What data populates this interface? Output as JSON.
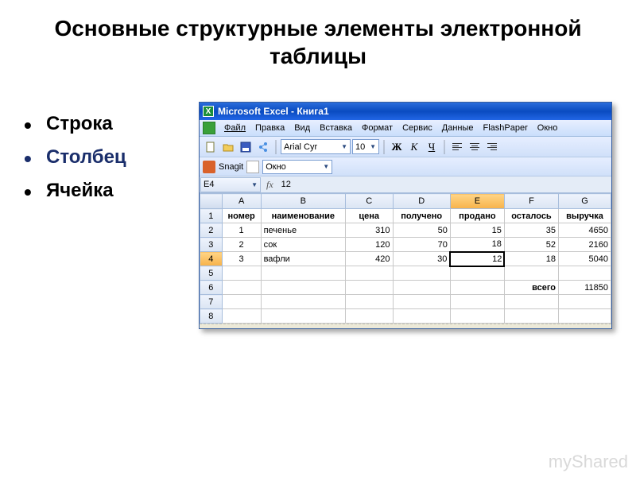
{
  "slide": {
    "title": "Основные структурные элементы электронной таблицы",
    "bullets": [
      "Строка",
      "Столбец",
      "Ячейка"
    ]
  },
  "excel": {
    "title": "Microsoft Excel - Книга1",
    "menu": [
      "Файл",
      "Правка",
      "Вид",
      "Вставка",
      "Формат",
      "Сервис",
      "Данные",
      "FlashPaper",
      "Окно"
    ],
    "font_name": "Arial Cyr",
    "font_size": "10",
    "bold": "Ж",
    "italic": "К",
    "underline": "Ч",
    "snag_label": "Snagit",
    "snag_window": "Окно",
    "cell_ref": "E4",
    "formula_value": "12",
    "columns": [
      "A",
      "B",
      "C",
      "D",
      "E",
      "F",
      "G"
    ],
    "headers": [
      "номер",
      "наименование",
      "цена",
      "получено",
      "продано",
      "осталось",
      "выручка"
    ],
    "rows": [
      {
        "n": "1",
        "cells": [
          "1",
          "печенье",
          "310",
          "50",
          "15",
          "35",
          "4650"
        ]
      },
      {
        "n": "2",
        "cells": [
          "2",
          "сок",
          "120",
          "70",
          "18",
          "52",
          "2160"
        ]
      },
      {
        "n": "3",
        "cells": [
          "3",
          "вафли",
          "420",
          "30",
          "12",
          "18",
          "5040"
        ]
      }
    ],
    "total_label": "всего",
    "total_value": "11850",
    "row_labels": [
      "1",
      "2",
      "3",
      "4",
      "5",
      "6",
      "7",
      "8"
    ]
  },
  "watermark": "myShared"
}
